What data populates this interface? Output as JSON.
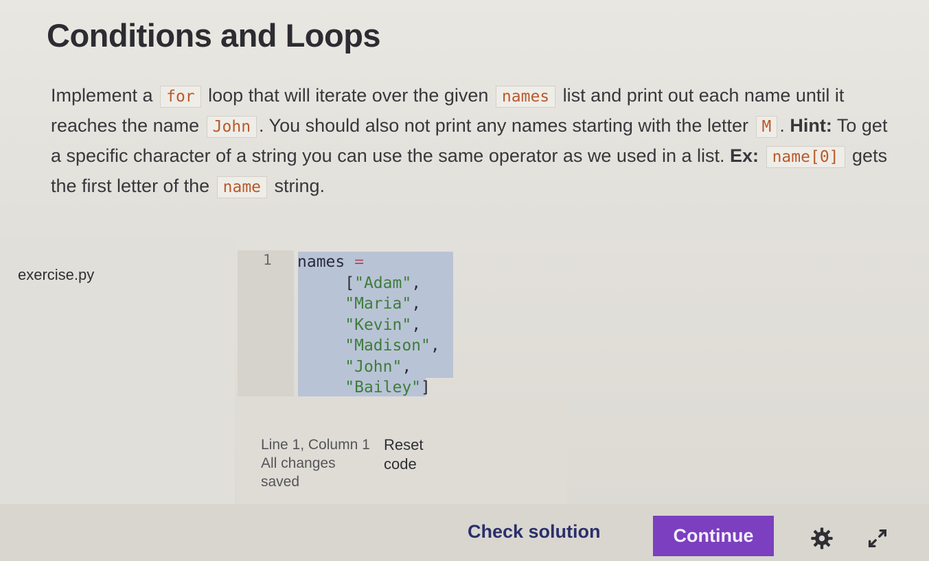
{
  "lesson": {
    "title": "Conditions and Loops",
    "instructions": {
      "p1": "Implement a",
      "c1": "for",
      "p2": "loop that will iterate over the given",
      "c2": "names",
      "p3": "list and print out each name until it reaches the name",
      "c3": "John",
      "p4": ". You should also not print any names starting with the letter",
      "c4": "M",
      "p5": ".",
      "hint_label": "Hint:",
      "p6": "To get a specific character of a string you can use the same operator as we used in a list.",
      "ex_label": "Ex:",
      "c5": "name[0]",
      "p7": "gets the first letter of the",
      "c6": "name",
      "p8": "string."
    }
  },
  "editor": {
    "file_name": "exercise.py",
    "line_number": "1",
    "code": {
      "var": "names",
      "op": "=",
      "open": "[",
      "items": [
        "\"Adam\"",
        "\"Maria\"",
        "\"Kevin\"",
        "\"Madison\"",
        "\"John\"",
        "\"Bailey\""
      ],
      "comma": ",",
      "close": "]"
    },
    "status": "Line 1, Column 1 All changes saved",
    "reset_label": "Reset code"
  },
  "actions": {
    "check_solution": "Check solution",
    "continue": "Continue"
  },
  "icons": {
    "settings": "gear-icon",
    "fullscreen": "expand-icon"
  },
  "colors": {
    "accent": "#7b3fbf",
    "link": "#2b2f6a",
    "inline_code": "#b85a2b",
    "selection": "#b9c3d6"
  }
}
